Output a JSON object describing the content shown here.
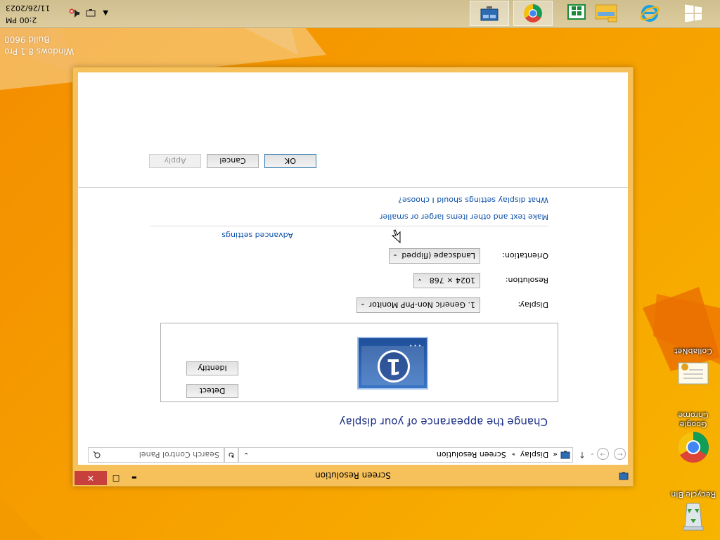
{
  "desktop": {
    "icons": [
      {
        "label": "Recycle Bin"
      },
      {
        "label": "Google Chrome"
      },
      {
        "label": "CollabNet"
      }
    ],
    "watermark": {
      "line1": "Windows 8.1 Pro",
      "line2": "Build 9600"
    }
  },
  "taskbar": {
    "clock": {
      "time": "2:00 PM",
      "date": "11/26/2023"
    },
    "pinned": [
      "start-icon",
      "internet-explorer-icon",
      "file-explorer-icon",
      "store-icon",
      "chrome-icon",
      "control-panel-icon"
    ]
  },
  "window": {
    "title": "Screen Resolution",
    "controls": {
      "minimize": "▬",
      "maximize": "☐",
      "close": "✕"
    },
    "address": {
      "back": "←",
      "forward": "→",
      "up": "↑",
      "chevron": "«",
      "crumbs": [
        "Display",
        "Screen Resolution"
      ],
      "separator": "▸",
      "dropdown": "⌄",
      "refresh": "↻"
    },
    "search": {
      "placeholder": "Search Control Panel"
    },
    "heading": "Change the appearance of your display",
    "preview": {
      "monitor_number": "1"
    },
    "buttons": {
      "detect": "Detect",
      "identify": "Identify",
      "ok": "OK",
      "cancel": "Cancel",
      "apply": "Apply"
    },
    "fields": {
      "display": {
        "label": "Display:",
        "value": "1. Generic Non-PnP Monitor"
      },
      "resolution": {
        "label": "Resolution:",
        "value": "1024 × 768"
      },
      "orientation": {
        "label": "Orientation:",
        "value": "Landscape (flipped)"
      }
    },
    "links": {
      "advanced": "Advanced settings",
      "text_size": "Make text and other items larger or smaller",
      "which_settings": "What display settings should I choose?"
    }
  },
  "colors": {
    "heading": "#1e3287",
    "link": "#0a4fa8",
    "close_button": "#c7403d",
    "desktop": "#f7a500"
  }
}
